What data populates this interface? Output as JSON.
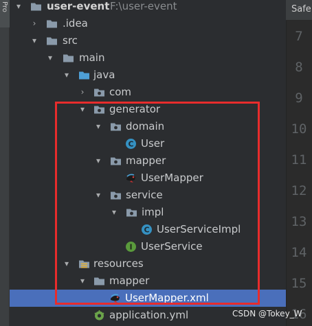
{
  "sidebar": {
    "tab_label": "Pro"
  },
  "editor": {
    "tab_label": "Safe"
  },
  "tree": {
    "project_name": "user-event",
    "project_path": "F:\\user-event",
    "idea": ".idea",
    "src": "src",
    "main": "main",
    "java": "java",
    "com": "com",
    "generator": "generator",
    "domain": "domain",
    "user": "User",
    "mapper": "mapper",
    "user_mapper": "UserMapper",
    "service": "service",
    "impl": "impl",
    "user_service_impl": "UserServiceImpl",
    "user_service": "UserService",
    "resources": "resources",
    "res_mapper": "mapper",
    "user_mapper_xml": "UserMapper.xml",
    "application_yml": "application.yml",
    "selected_item": "UserMapper.xml"
  },
  "line_numbers": [
    "7",
    "8",
    "9",
    "10",
    "11",
    "12",
    "13",
    "14",
    "15",
    "16"
  ],
  "watermark": "CSDN @Tokey_W",
  "colors": {
    "selection": "#4a6fbb",
    "highlight_box": "#e82c2c",
    "folder": "#8a9aaa",
    "source_folder": "#4e9fd6",
    "class_icon": "#3591c2",
    "interface_icon": "#5a9a3c"
  }
}
